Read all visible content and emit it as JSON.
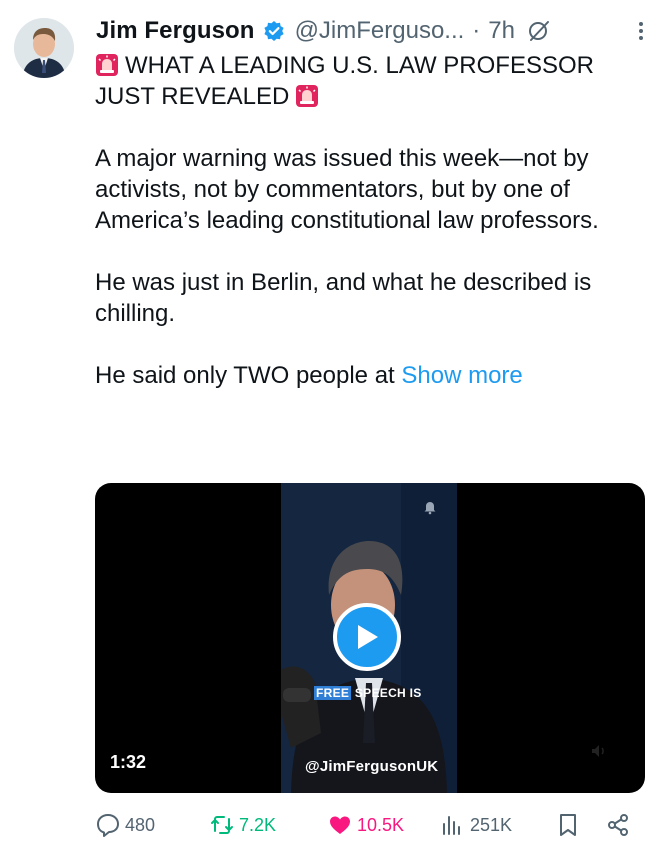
{
  "author": {
    "name": "Jim Ferguson",
    "handle": "@JimFerguso...",
    "dot": "·",
    "time": "7h"
  },
  "tweet": {
    "headline_line1": "WHAT A LEADING U.S. LAW PROFESSOR",
    "headline_line2": "JUST REVEALED",
    "paragraph1": "A major warning was issued this week—not by activists, not by commentators, but by one of America’s leading constitutional law professors.",
    "paragraph2": "He was just in Berlin, and what he described is chilling.",
    "paragraph3": "He said only TWO people at",
    "show_more": "Show more"
  },
  "media": {
    "duration": "1:32",
    "caption_highlight": "FREE",
    "caption_rest": " SPEECH IS",
    "watermark": "@JimFergusonUK"
  },
  "actions": {
    "replies": "480",
    "reposts": "7.2K",
    "likes": "10.5K",
    "views": "251K"
  },
  "colors": {
    "accent": "#1d9bf0",
    "repost": "#00ba7c",
    "like": "#f91880",
    "muted": "#536471",
    "alarm": "#e0245e"
  },
  "icons": [
    "verified-badge-icon",
    "grok-icon",
    "more-icon",
    "siren-icon",
    "play-icon",
    "reply-icon",
    "repost-icon",
    "like-icon",
    "views-icon",
    "bookmark-icon",
    "share-icon"
  ]
}
